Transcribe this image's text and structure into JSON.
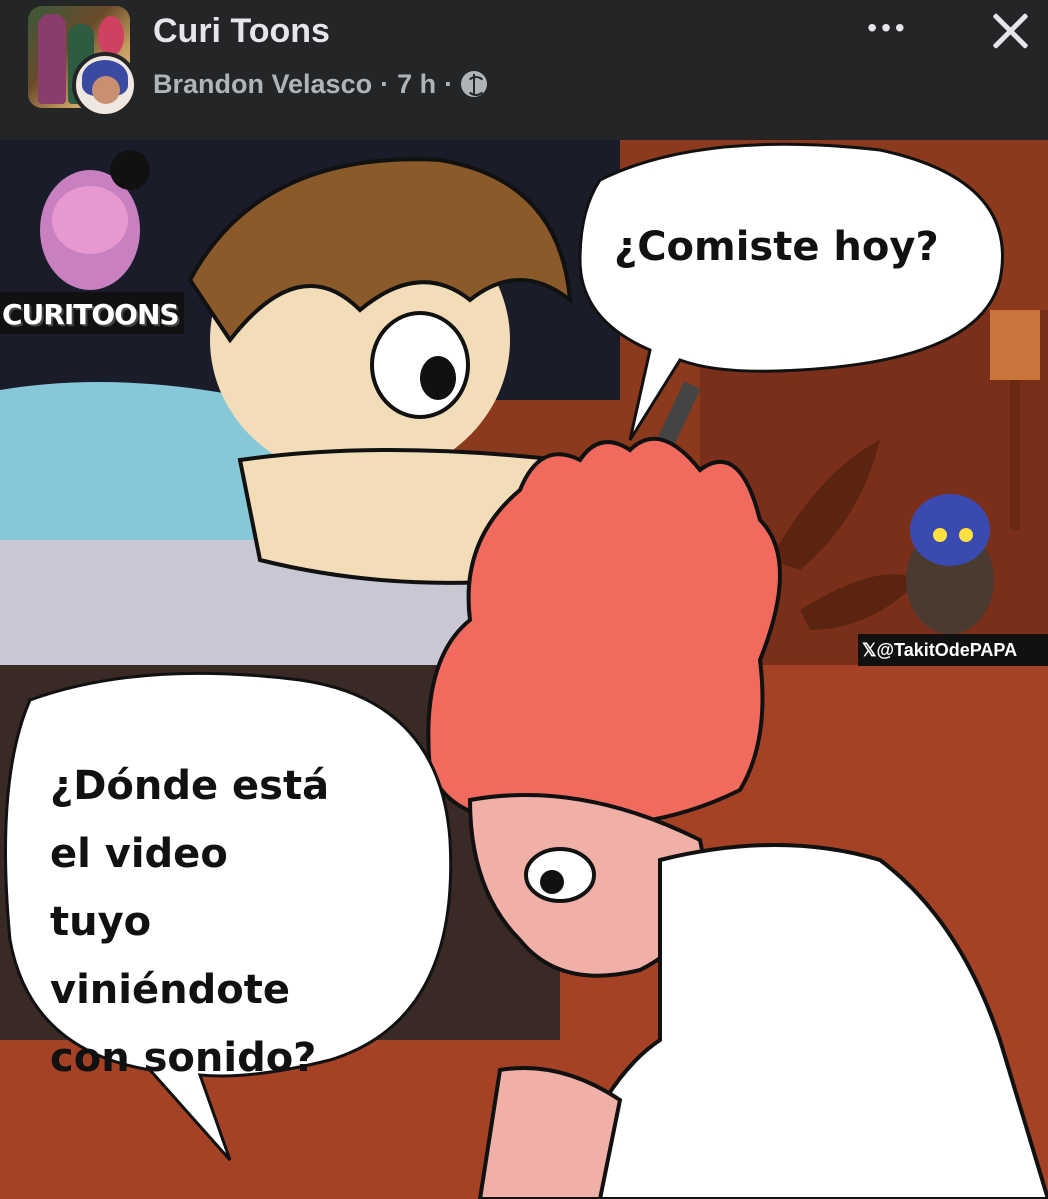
{
  "header": {
    "page_name": "Curi Toons",
    "author": "Brandon Velasco",
    "separator": "·",
    "time": "7 h",
    "privacy_icon": "globe-icon",
    "more_label": "•••",
    "more_icon": "more-icon",
    "close_icon": "close-icon"
  },
  "image": {
    "speech_top": "¿Comiste hoy?",
    "speech_bottom": "¿Dónde está\nel video\ntuyo\nviniéndote\ncon sonido?",
    "watermark_brand": "CURITOONS",
    "watermark_handle": "𝕏@TakitOdePAPA"
  }
}
